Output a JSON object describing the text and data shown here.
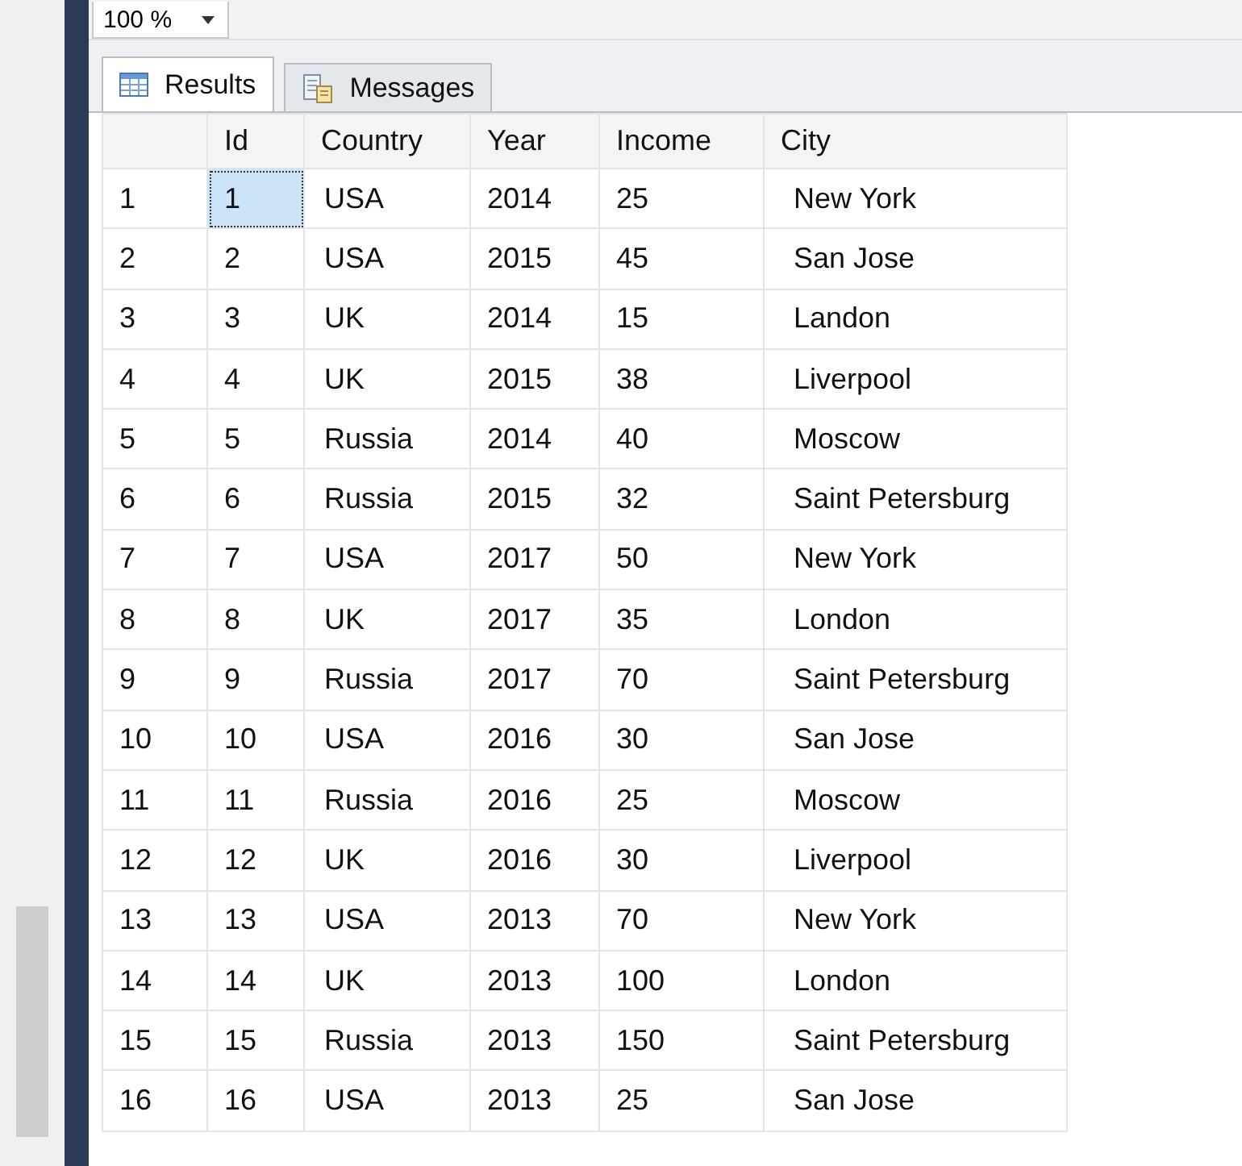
{
  "zoom": {
    "value": "100 %"
  },
  "tabs": [
    {
      "label": "Results",
      "kind": "grid",
      "selected": true
    },
    {
      "label": "Messages",
      "kind": "messages",
      "selected": false
    }
  ],
  "table": {
    "columns": [
      "Id",
      "Country",
      "Year",
      "Income",
      "City"
    ],
    "rows": [
      {
        "number": "1",
        "cells": [
          {
            "text": "1",
            "selected": true
          },
          {
            "text": "USA",
            "selected": false
          },
          {
            "text": "2014",
            "selected": false
          },
          {
            "text": "25",
            "selected": false
          },
          {
            "text": "New York",
            "selected": false
          }
        ]
      },
      {
        "number": "2",
        "cells": [
          {
            "text": "2",
            "selected": false
          },
          {
            "text": "USA",
            "selected": false
          },
          {
            "text": "2015",
            "selected": false
          },
          {
            "text": "45",
            "selected": false
          },
          {
            "text": "San Jose",
            "selected": false
          }
        ]
      },
      {
        "number": "3",
        "cells": [
          {
            "text": "3",
            "selected": false
          },
          {
            "text": "UK",
            "selected": false
          },
          {
            "text": "2014",
            "selected": false
          },
          {
            "text": "15",
            "selected": false
          },
          {
            "text": "Landon",
            "selected": false
          }
        ]
      },
      {
        "number": "4",
        "cells": [
          {
            "text": "4",
            "selected": false
          },
          {
            "text": "UK",
            "selected": false
          },
          {
            "text": "2015",
            "selected": false
          },
          {
            "text": "38",
            "selected": false
          },
          {
            "text": "Liverpool",
            "selected": false
          }
        ]
      },
      {
        "number": "5",
        "cells": [
          {
            "text": "5",
            "selected": false
          },
          {
            "text": "Russia",
            "selected": false
          },
          {
            "text": "2014",
            "selected": false
          },
          {
            "text": "40",
            "selected": false
          },
          {
            "text": "Moscow",
            "selected": false
          }
        ]
      },
      {
        "number": "6",
        "cells": [
          {
            "text": "6",
            "selected": false
          },
          {
            "text": "Russia",
            "selected": false
          },
          {
            "text": "2015",
            "selected": false
          },
          {
            "text": "32",
            "selected": false
          },
          {
            "text": "Saint Petersburg",
            "selected": false
          }
        ]
      },
      {
        "number": "7",
        "cells": [
          {
            "text": "7",
            "selected": false
          },
          {
            "text": "USA",
            "selected": false
          },
          {
            "text": "2017",
            "selected": false
          },
          {
            "text": "50",
            "selected": false
          },
          {
            "text": "New York",
            "selected": false
          }
        ]
      },
      {
        "number": "8",
        "cells": [
          {
            "text": "8",
            "selected": false
          },
          {
            "text": "UK",
            "selected": false
          },
          {
            "text": "2017",
            "selected": false
          },
          {
            "text": "35",
            "selected": false
          },
          {
            "text": "London",
            "selected": false
          }
        ]
      },
      {
        "number": "9",
        "cells": [
          {
            "text": "9",
            "selected": false
          },
          {
            "text": "Russia",
            "selected": false
          },
          {
            "text": "2017",
            "selected": false
          },
          {
            "text": "70",
            "selected": false
          },
          {
            "text": "Saint Petersburg",
            "selected": false
          }
        ]
      },
      {
        "number": "10",
        "cells": [
          {
            "text": "10",
            "selected": false
          },
          {
            "text": "USA",
            "selected": false
          },
          {
            "text": "2016",
            "selected": false
          },
          {
            "text": "30",
            "selected": false
          },
          {
            "text": "San Jose",
            "selected": false
          }
        ]
      },
      {
        "number": "11",
        "cells": [
          {
            "text": "11",
            "selected": false
          },
          {
            "text": "Russia",
            "selected": false
          },
          {
            "text": "2016",
            "selected": false
          },
          {
            "text": "25",
            "selected": false
          },
          {
            "text": "Moscow",
            "selected": false
          }
        ]
      },
      {
        "number": "12",
        "cells": [
          {
            "text": "12",
            "selected": false
          },
          {
            "text": "UK",
            "selected": false
          },
          {
            "text": "2016",
            "selected": false
          },
          {
            "text": "30",
            "selected": false
          },
          {
            "text": "Liverpool",
            "selected": false
          }
        ]
      },
      {
        "number": "13",
        "cells": [
          {
            "text": "13",
            "selected": false
          },
          {
            "text": "USA",
            "selected": false
          },
          {
            "text": "2013",
            "selected": false
          },
          {
            "text": "70",
            "selected": false
          },
          {
            "text": "New York",
            "selected": false
          }
        ]
      },
      {
        "number": "14",
        "cells": [
          {
            "text": "14",
            "selected": false
          },
          {
            "text": "UK",
            "selected": false
          },
          {
            "text": "2013",
            "selected": false
          },
          {
            "text": "100",
            "selected": false
          },
          {
            "text": "London",
            "selected": false
          }
        ]
      },
      {
        "number": "15",
        "cells": [
          {
            "text": "15",
            "selected": false
          },
          {
            "text": "Russia",
            "selected": false
          },
          {
            "text": "2013",
            "selected": false
          },
          {
            "text": "150",
            "selected": false
          },
          {
            "text": "Saint Petersburg",
            "selected": false
          }
        ]
      },
      {
        "number": "16",
        "cells": [
          {
            "text": "16",
            "selected": false
          },
          {
            "text": "USA",
            "selected": false
          },
          {
            "text": "2013",
            "selected": false
          },
          {
            "text": "25",
            "selected": false
          },
          {
            "text": "San Jose",
            "selected": false
          }
        ]
      }
    ]
  }
}
